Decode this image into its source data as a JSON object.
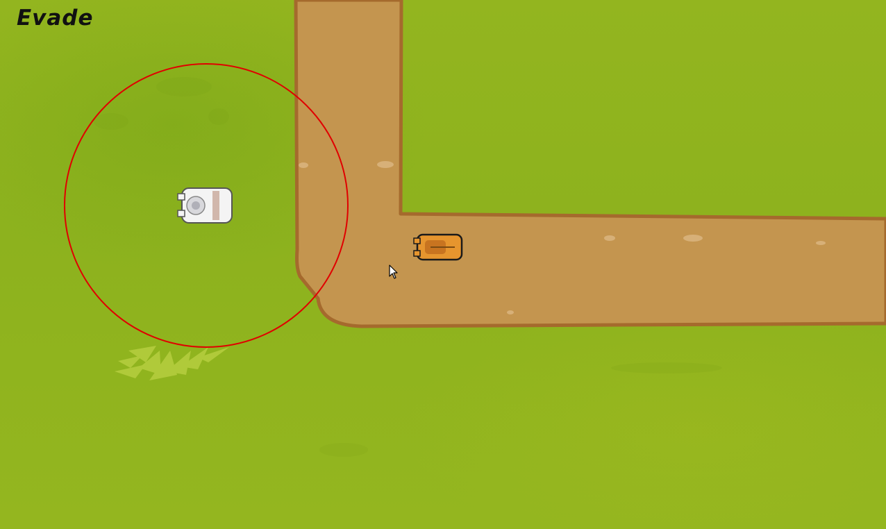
{
  "hud": {
    "mode_label": "Evade"
  },
  "colors": {
    "grass": "#8fb21f",
    "path": "#c4954f",
    "path_edge": "#a56a2d",
    "range_ring": "#e00000"
  },
  "units": [
    {
      "role": "tower",
      "sprite": "white-tower-sprite"
    },
    {
      "role": "enemy",
      "sprite": "orange-creep-sprite"
    }
  ]
}
